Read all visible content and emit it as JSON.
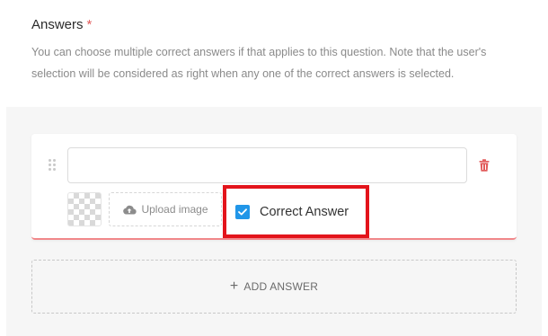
{
  "answers_section": {
    "title": "Answers",
    "required_mark": "*",
    "description": "You can choose multiple correct answers if that applies to this question. Note that the user's selection will be considered as right when any one of the correct answers is selected."
  },
  "answer_item": {
    "input_value": "",
    "upload_label": "Upload image",
    "correct_label": "Correct Answer",
    "correct_checked": true
  },
  "add_answer": {
    "label": "ADD ANSWER",
    "icon": "+"
  },
  "colors": {
    "accent": "#2196e8",
    "danger": "#e25b5b",
    "highlight": "#e3141b"
  }
}
